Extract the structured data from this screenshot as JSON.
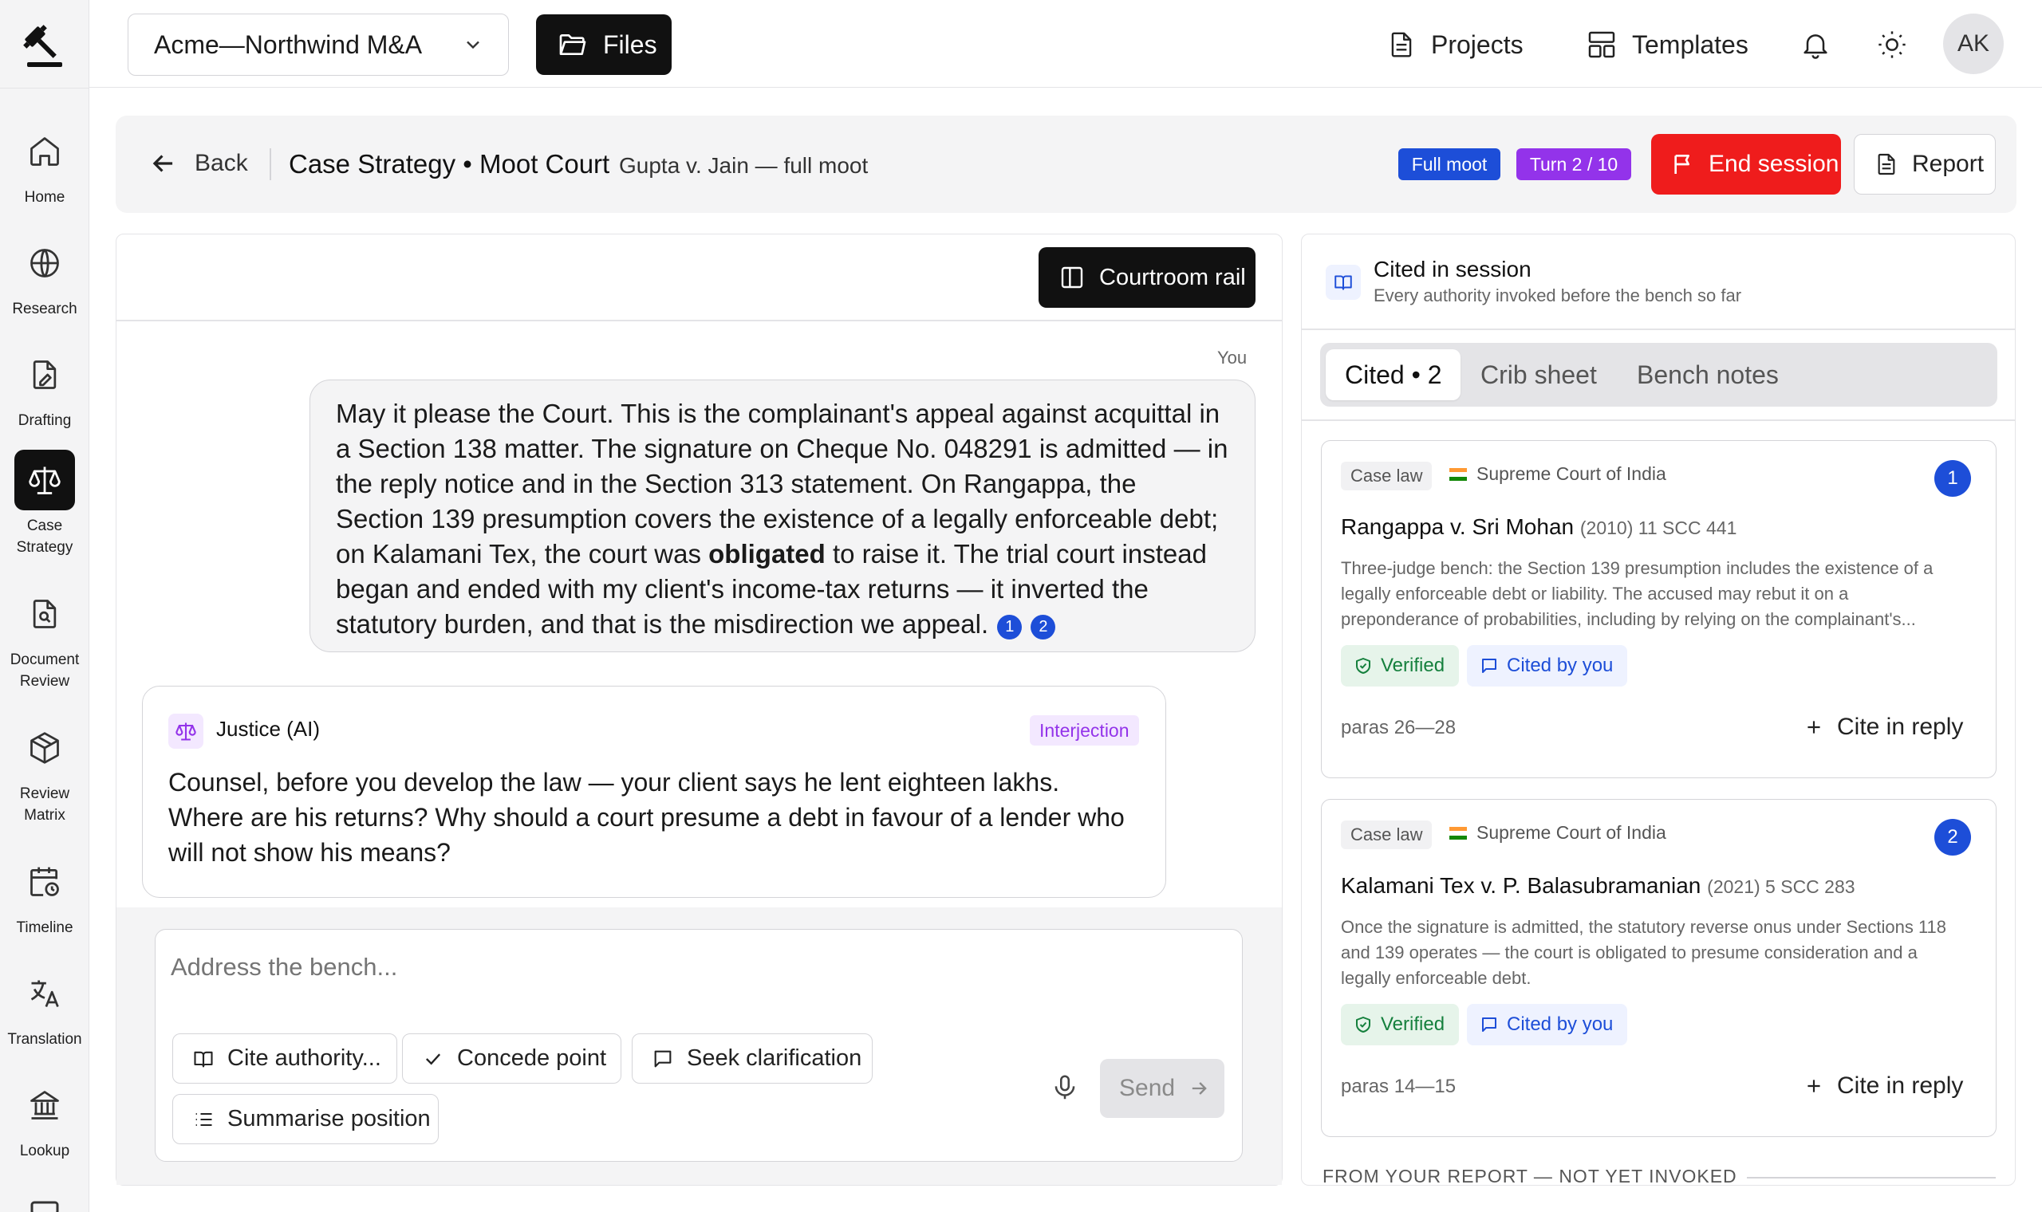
{
  "nav": {
    "items": [
      {
        "label": "Home",
        "icon": "home-icon"
      },
      {
        "label": "Research",
        "icon": "globe-icon"
      },
      {
        "label": "Drafting",
        "icon": "drafting-icon"
      },
      {
        "label": "Case Strategy",
        "icon": "scales-icon",
        "active": true
      },
      {
        "label": "Document Review",
        "icon": "document-search-icon"
      },
      {
        "label": "Review Matrix",
        "icon": "cube-icon"
      },
      {
        "label": "Timeline",
        "icon": "calendar-clock-icon"
      },
      {
        "label": "Translation",
        "icon": "translate-icon"
      },
      {
        "label": "Lookup",
        "icon": "bank-icon"
      }
    ]
  },
  "topbar": {
    "workspace": "Acme—Northwind M&A",
    "files": "Files",
    "projects": "Projects",
    "templates": "Templates",
    "avatar": "AK"
  },
  "header": {
    "back": "Back",
    "title": "Case Strategy • Moot Court",
    "subtitle": "Gupta v. Jain — full moot",
    "mode_badge": "Full moot",
    "turn_badge": "Turn 2 / 10",
    "end_session": "End session",
    "report": "Report",
    "colors": {
      "mode": "#1d4ed8",
      "turn": "#9333ea",
      "end": "#ef1c1c"
    }
  },
  "chat": {
    "courtroom_rail": "Courtroom rail",
    "you_label": "You",
    "user_message": {
      "before_bold": "May it please the Court. This is the complainant's appeal against acquittal in a Section 138 matter. The signature on Cheque No. 048291 is admitted — in the reply notice and in the Section 313 statement. On Rangappa, the Section 139 presumption covers the existence of a legally enforceable debt; on Kalamani Tex, the court was ",
      "bold": "obligated",
      "after_bold": " to raise it. The trial court instead began and ended with my client's income-tax returns — it inverted the statutory burden, and that is the misdirection we appeal.",
      "cite1": "1",
      "cite2": "2"
    },
    "justice": {
      "name": "Justice (AI)",
      "badge": "Interjection",
      "message": "Counsel, before you develop the law — your client says he lent eighteen lakhs. Where are his returns? Why should a court presume a debt in favour of a lender who will not show his means?"
    },
    "composer": {
      "placeholder": "Address the bench...",
      "chips": [
        "Cite authority...",
        "Concede point",
        "Seek clarification",
        "Summarise position"
      ],
      "send": "Send"
    }
  },
  "cited": {
    "title": "Cited in session",
    "subtitle": "Every authority invoked before the bench so far",
    "tabs": [
      "Cited • 2",
      "Crib sheet",
      "Bench notes"
    ],
    "cards": [
      {
        "type": "Case law",
        "court": "Supreme Court of India",
        "number": "1",
        "case_name": "Rangappa v. Sri Mohan",
        "citation": "(2010) 11 SCC 441",
        "description": "Three-judge bench: the Section 139 presumption includes the existence of a legally enforceable debt or liability. The accused may rebut it on a preponderance of probabilities, including by relying on the complainant's...",
        "verified": "Verified",
        "cited_by": "Cited by you",
        "paras": "paras 26—28",
        "cite_reply": "Cite in reply"
      },
      {
        "type": "Case law",
        "court": "Supreme Court of India",
        "number": "2",
        "case_name": "Kalamani Tex v. P. Balasubramanian",
        "citation": "(2021) 5 SCC 283",
        "description": "Once the signature is admitted, the statutory reverse onus under Sections 118 and 139 operates — the court is obligated to presume consideration and a legally enforceable debt.",
        "verified": "Verified",
        "cited_by": "Cited by you",
        "paras": "paras 14—15",
        "cite_reply": "Cite in reply"
      }
    ],
    "section_footer": "FROM YOUR REPORT — NOT YET INVOKED"
  }
}
